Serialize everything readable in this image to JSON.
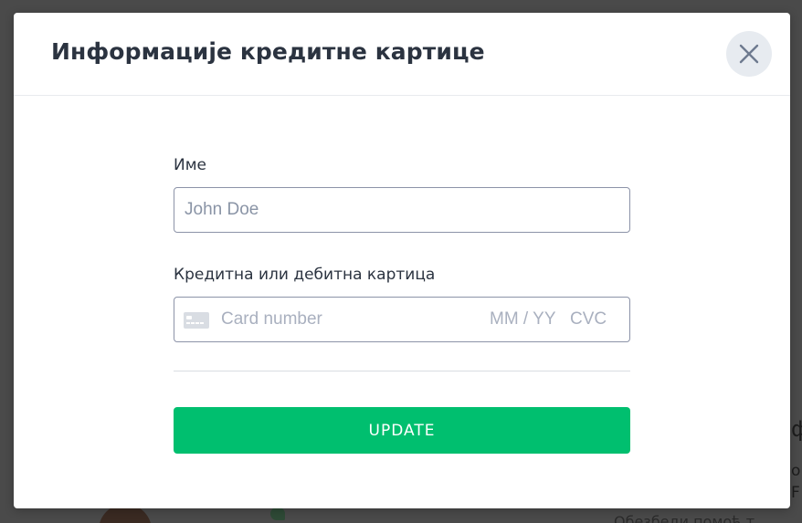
{
  "modal": {
    "title": "Информације кредитне картице",
    "close_icon": "close-icon"
  },
  "form": {
    "name_label": "Име",
    "name_placeholder": "John Doe",
    "card_label": "Кредитна или дебитна картица",
    "card_icon": "credit-card-icon",
    "card_number_placeholder": "Card number",
    "expiry_placeholder": "MM / YY",
    "cvc_placeholder": "CVC",
    "submit_label": "UPDATE"
  },
  "background": {
    "fragment_1": "ф",
    "fragment_2": "о",
    "fragment_3": "F",
    "fragment_4": "Обезбеди помоћ т"
  },
  "colors": {
    "accent": "#00bf6f",
    "title": "#2b3340",
    "input_border": "#8c93a8",
    "close_bg": "#e7ebf0",
    "overlay": "#4a4a4a"
  }
}
